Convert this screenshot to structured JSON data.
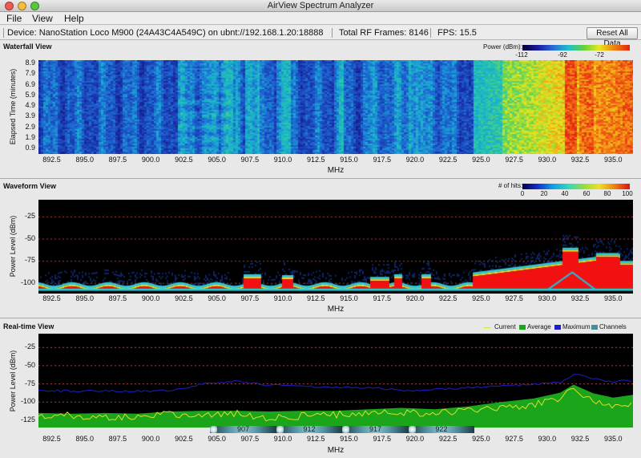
{
  "window": {
    "title": "AirView Spectrum Analyzer"
  },
  "menu": [
    "File",
    "View",
    "Help"
  ],
  "info": {
    "device": "Device: NanoStation Loco M900 (24A43C4A549C) on ubnt://192.168.1.20:18888",
    "frames": "Total RF Frames: 8146",
    "fps": "FPS: 15.5",
    "reset_label": "Reset All Data"
  },
  "waterfall": {
    "title": "Waterfall View",
    "ylabel": "Elapsed Time (minutes)",
    "xlabel": "MHz",
    "yticks": [
      "8.9",
      "7.9",
      "6.9",
      "5.9",
      "4.9",
      "3.9",
      "2.9",
      "1.9",
      "0.9"
    ],
    "scale_label": "Power (dBm):",
    "scale_ticks": [
      "-112",
      "-92",
      "-72"
    ]
  },
  "waveform": {
    "title": "Waveform View",
    "ylabel": "Power Level (dBm)",
    "xlabel": "MHz",
    "yticks": [
      "-25",
      "-50",
      "-75",
      "-100"
    ],
    "scale_label": "# of hits:",
    "scale_ticks": [
      "0",
      "20",
      "40",
      "60",
      "80",
      "100"
    ]
  },
  "realtime": {
    "title": "Real-time View",
    "ylabel": "Power Level (dBm)",
    "xlabel": "MHz",
    "yticks": [
      "-25",
      "-50",
      "-75",
      "-100",
      "-125"
    ],
    "legend": [
      "Current",
      "Average",
      "Maximum",
      "Channels"
    ],
    "channels": [
      "907",
      "912",
      "917",
      "922"
    ]
  },
  "xticks": [
    "892.5",
    "895.0",
    "897.5",
    "900.0",
    "902.5",
    "905.0",
    "907.5",
    "910.0",
    "912.5",
    "915.0",
    "917.5",
    "920.0",
    "922.5",
    "925.0",
    "927.5",
    "930.0",
    "932.5",
    "935.0"
  ],
  "colors": {
    "current": "#d8e030",
    "average": "#1aa51a",
    "maximum": "#1e1ec8",
    "channels": "#4a8c99"
  },
  "chart_data": [
    {
      "type": "heatmap",
      "title": "Waterfall View",
      "xlabel": "MHz",
      "ylabel": "Elapsed Time (minutes)",
      "xlim": [
        891.5,
        936.5
      ],
      "ylim": [
        0.4,
        9.2
      ],
      "scale": "Power (dBm)",
      "scale_ticks": [
        -112,
        -92,
        -72
      ],
      "notes_high_power_mhz": [
        907.5,
        910.0,
        931.8,
        934.3
      ]
    },
    {
      "type": "heatmap",
      "title": "Waveform View",
      "xlabel": "MHz",
      "ylabel": "Power Level (dBm)",
      "xlim": [
        891.5,
        936.5
      ],
      "ylim": [
        -112,
        -6
      ],
      "scale": "# of hits",
      "scale_ticks": [
        0,
        20,
        40,
        60,
        80,
        100
      ]
    },
    {
      "type": "line",
      "title": "Real-time View",
      "xlabel": "MHz",
      "ylabel": "Power Level (dBm)",
      "xlim": [
        891.5,
        936.5
      ],
      "ylim": [
        -135,
        -6
      ],
      "x": [
        891.5,
        894.0,
        896.5,
        899.0,
        901.5,
        904.0,
        906.5,
        909.0,
        911.5,
        914.0,
        916.5,
        919.0,
        921.5,
        924.0,
        926.5,
        929.0,
        931.0,
        932.0,
        933.5,
        935.0,
        936.5
      ],
      "series": [
        {
          "name": "Average",
          "values": [
            -115,
            -116,
            -115,
            -116,
            -113,
            -112,
            -112,
            -113,
            -112,
            -112,
            -110,
            -108,
            -110,
            -106,
            -100,
            -95,
            -87,
            -76,
            -88,
            -94,
            -90
          ]
        },
        {
          "name": "Maximum",
          "values": [
            -84,
            -85,
            -85,
            -85,
            -84,
            -75,
            -72,
            -77,
            -78,
            -80,
            -80,
            -84,
            -83,
            -80,
            -78,
            -76,
            -73,
            -62,
            -68,
            -72,
            -70
          ]
        },
        {
          "name": "Current",
          "values": [
            -120,
            -118,
            -121,
            -119,
            -117,
            -118,
            -116,
            -122,
            -119,
            -117,
            -115,
            -114,
            -116,
            -112,
            -108,
            -104,
            -95,
            -80,
            -100,
            -106,
            -104
          ]
        }
      ],
      "channels": [
        {
          "label": "907",
          "from": 904.5,
          "to": 909.5
        },
        {
          "label": "912",
          "from": 909.5,
          "to": 914.5
        },
        {
          "label": "917",
          "from": 914.5,
          "to": 919.5
        },
        {
          "label": "922",
          "from": 919.5,
          "to": 924.5
        }
      ]
    }
  ]
}
